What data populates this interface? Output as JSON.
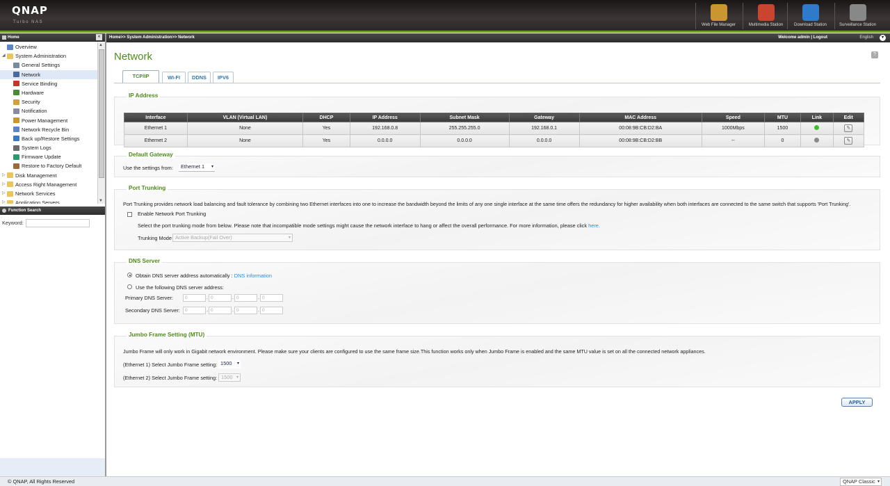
{
  "header": {
    "logo": "QNAP",
    "logo_sub": "Turbo NAS",
    "apps": [
      {
        "label": "Web File Manager",
        "icon": "folder-icon",
        "color": "#c9962f"
      },
      {
        "label": "Multimedia Station",
        "icon": "film-icon",
        "color": "#c9452f"
      },
      {
        "label": "Download Station",
        "icon": "globe-download-icon",
        "color": "#2f7bc9"
      },
      {
        "label": "Surveillance Station",
        "icon": "camera-icon",
        "color": "#888888"
      }
    ]
  },
  "breadcrumb": "Home>> System Administration>> Network",
  "welcome": "Welcome admin | Logout",
  "language": "English",
  "sidebar": {
    "home_label": "Home",
    "tree": [
      {
        "label": "Overview",
        "level": 1,
        "color": "#5a86c4"
      },
      {
        "label": "System Administration",
        "level": 0,
        "color": "#e9c65a",
        "expanded": true
      },
      {
        "label": "General Settings",
        "level": 2,
        "color": "#7a8a9a"
      },
      {
        "label": "Network",
        "level": 2,
        "color": "#4a6a9a",
        "selected": true
      },
      {
        "label": "Service Binding",
        "level": 2,
        "color": "#c0392b"
      },
      {
        "label": "Hardware",
        "level": 2,
        "color": "#4a8a3a"
      },
      {
        "label": "Security",
        "level": 2,
        "color": "#d4a03a"
      },
      {
        "label": "Notification",
        "level": 2,
        "color": "#8a8aa0"
      },
      {
        "label": "Power Management",
        "level": 2,
        "color": "#c9962f"
      },
      {
        "label": "Network Recycle Bin",
        "level": 2,
        "color": "#5a86c4"
      },
      {
        "label": "Back up/Restore Settings",
        "level": 2,
        "color": "#3a7ac4"
      },
      {
        "label": "System Logs",
        "level": 2,
        "color": "#6a6a6a"
      },
      {
        "label": "Firmware Update",
        "level": 2,
        "color": "#2a9a6a"
      },
      {
        "label": "Restore to Factory Default",
        "level": 2,
        "color": "#9a6a3a"
      },
      {
        "label": "Disk Management",
        "level": 0,
        "color": "#e9c65a"
      },
      {
        "label": "Access Right Management",
        "level": 0,
        "color": "#e9c65a"
      },
      {
        "label": "Network Services",
        "level": 0,
        "color": "#e9c65a"
      },
      {
        "label": "Application Servers",
        "level": 0,
        "color": "#e9c65a"
      }
    ],
    "function_search": "Function Search",
    "keyword_label": "Keyword:"
  },
  "main": {
    "title": "Network",
    "tabs": [
      "TCP/IP",
      "WI-FI",
      "DDNS",
      "IPV6"
    ],
    "ip_address": {
      "title": "IP Address",
      "columns": [
        "Interface",
        "VLAN (Virtual LAN)",
        "DHCP",
        "IP Address",
        "Subnet Mask",
        "Gateway",
        "MAC Address",
        "Speed",
        "MTU",
        "Link",
        "Edit"
      ],
      "rows": [
        {
          "interface": "Ethernet 1",
          "vlan": "None",
          "dhcp": "Yes",
          "ip": "192.168.0.8",
          "mask": "255.255.255.0",
          "gateway": "192.168.0.1",
          "mac": "00:08:9B:CB:D2:BA",
          "speed": "1000Mbps",
          "mtu": "1500",
          "link_color": "#3fbf2f"
        },
        {
          "interface": "Ethernet 2",
          "vlan": "None",
          "dhcp": "Yes",
          "ip": "0.0.0.0",
          "mask": "0.0.0.0",
          "gateway": "0.0.0.0",
          "mac": "00:08:9B:CB:D2:BB",
          "speed": "--",
          "mtu": "0",
          "link_color": "#8a8a8a"
        }
      ]
    },
    "default_gateway": {
      "title": "Default Gateway",
      "label": "Use the settings from:",
      "value": "Ethernet 1"
    },
    "port_trunking": {
      "title": "Port Trunking",
      "description": "Port Trunking provides network load balancing and fault tolerance by combining two Ethernet interfaces into one to increase the bandwidth beyond the limits of any one single interface at the same time offers the redundancy for higher availability when both interfaces are connected to the same switch that supports 'Port Trunking'.",
      "enable_label": "Enable Network Port Trunking",
      "note": "Select the port trunking mode from below. Please note that incompatible mode settings might cause the network interface to hang or affect the overall performance. For more information, please click",
      "note_link": "here.",
      "mode_label": "Trunking Mode",
      "mode_value": "Active Backup(Fail Over)"
    },
    "dns": {
      "title": "DNS Server",
      "auto_label": "Obtain DNS server address automatically :",
      "auto_link": "DNS information",
      "manual_label": "Use the following DNS server address:",
      "primary_label": "Primary DNS Server:",
      "secondary_label": "Secondary DNS Server:",
      "octet": "0"
    },
    "jumbo": {
      "title": "Jumbo Frame Setting (MTU)",
      "description": "Jumbo Frame will only work in Gigabit network environment. Please make sure your clients are configured to use the same frame size.This function works only when Jumbo Frame is enabled and the same MTU value is set on all the connected network appliances.",
      "eth1_label": "(Ethernet 1) Select Jumbo Frame setting:",
      "eth1_value": "1500",
      "eth2_label": "(Ethernet 2) Select Jumbo Frame setting:",
      "eth2_value": "1500"
    },
    "apply_label": "APPLY"
  },
  "footer": {
    "copyright": "© QNAP, All Rights Reserved",
    "theme": "QNAP Classic"
  }
}
